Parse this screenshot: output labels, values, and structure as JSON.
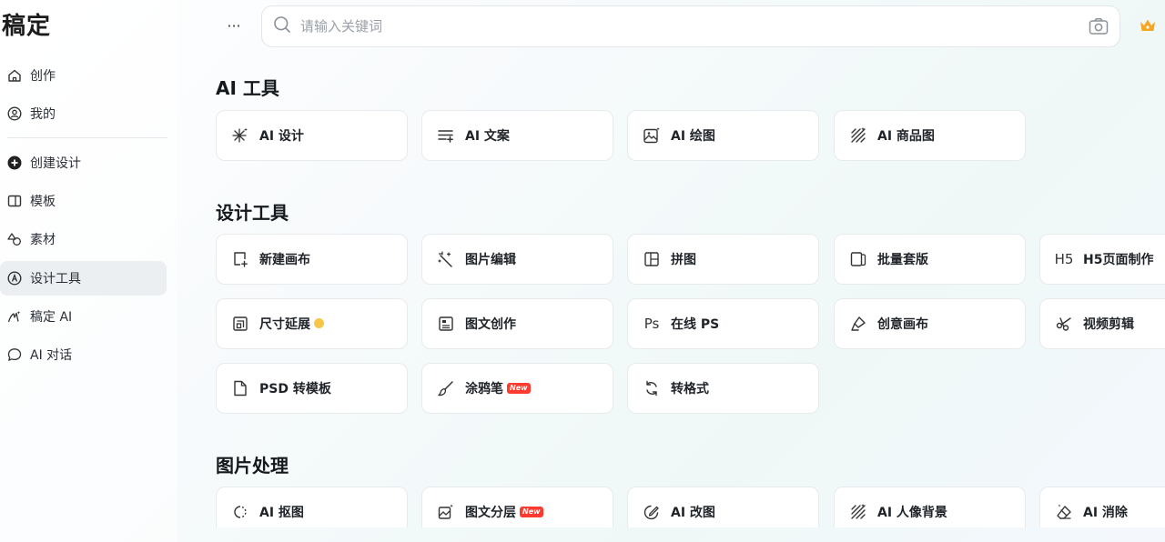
{
  "app": {
    "logo": "稿定"
  },
  "sidebar": {
    "items": [
      {
        "label": "创作",
        "icon": "home-icon"
      },
      {
        "label": "我的",
        "icon": "user-icon"
      },
      {
        "label": "创建设计",
        "icon": "plus-circle-icon"
      },
      {
        "label": "模板",
        "icon": "template-icon"
      },
      {
        "label": "素材",
        "icon": "shapes-icon"
      },
      {
        "label": "设计工具",
        "icon": "compass-icon",
        "active": true
      },
      {
        "label": "稿定 AI",
        "icon": "ai-brush-icon"
      },
      {
        "label": "AI 对话",
        "icon": "chat-icon"
      }
    ]
  },
  "header": {
    "more_label": "···",
    "search_placeholder": "请输入关键词",
    "accent_color": "#f5a623"
  },
  "sections": [
    {
      "title": "AI 工具",
      "cards": [
        {
          "label": "AI 设计",
          "icon": "sparkle-icon"
        },
        {
          "label": "AI 文案",
          "icon": "text-lines-icon"
        },
        {
          "label": "AI 绘图",
          "icon": "image-sparkle-icon"
        },
        {
          "label": "AI 商品图",
          "icon": "hatch-icon"
        }
      ]
    },
    {
      "title": "设计工具",
      "cards": [
        {
          "label": "新建画布",
          "icon": "new-canvas-icon"
        },
        {
          "label": "图片编辑",
          "icon": "magic-wand-icon"
        },
        {
          "label": "拼图",
          "icon": "collage-icon"
        },
        {
          "label": "批量套版",
          "icon": "batch-icon"
        },
        {
          "label": "H5页面制作",
          "icon": "h5-icon",
          "glyph": "H5"
        },
        {
          "label": "尺寸延展",
          "icon": "resize-icon",
          "badge": "vip"
        },
        {
          "label": "图文创作",
          "icon": "document-icon"
        },
        {
          "label": "在线 PS",
          "icon": "ps-icon",
          "glyph": "Ps"
        },
        {
          "label": "创意画布",
          "icon": "creative-icon"
        },
        {
          "label": "视频剪辑",
          "icon": "scissors-icon"
        },
        {
          "label": "PSD 转模板",
          "icon": "file-icon"
        },
        {
          "label": "涂鸦笔",
          "icon": "brush-icon",
          "badge": "New"
        },
        {
          "label": "转格式",
          "icon": "convert-icon"
        }
      ]
    },
    {
      "title": "图片处理",
      "cards": [
        {
          "label": "AI 抠图",
          "icon": "cutout-icon"
        },
        {
          "label": "图文分层",
          "icon": "layers-icon",
          "badge": "New"
        },
        {
          "label": "AI 改图",
          "icon": "edit-image-icon"
        },
        {
          "label": "AI 人像背景",
          "icon": "hatch-icon"
        },
        {
          "label": "AI 消除",
          "icon": "eraser-icon"
        }
      ]
    }
  ]
}
